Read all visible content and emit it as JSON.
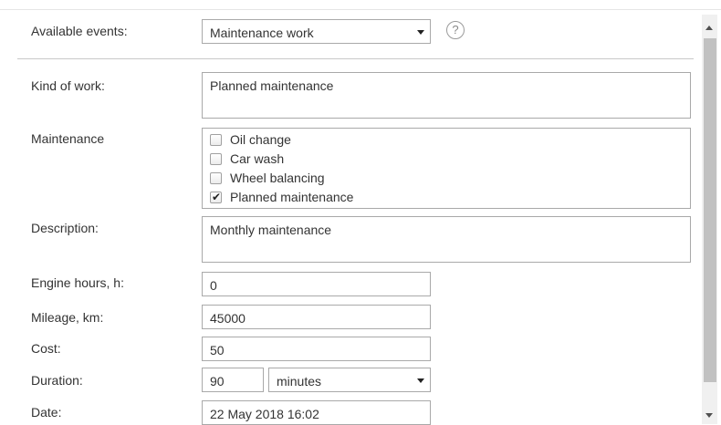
{
  "fields": {
    "available_events": {
      "label": "Available events:",
      "value": "Maintenance work"
    },
    "help": {
      "glyph": "?"
    },
    "kind_of_work": {
      "label": "Kind of work:",
      "value": "Planned maintenance"
    },
    "maintenance": {
      "label": "Maintenance",
      "options": [
        {
          "label": "Oil change",
          "checked": false
        },
        {
          "label": "Car wash",
          "checked": false
        },
        {
          "label": "Wheel balancing",
          "checked": false
        },
        {
          "label": "Planned maintenance",
          "checked": true
        }
      ]
    },
    "description": {
      "label": "Description:",
      "value": "Monthly maintenance"
    },
    "engine_hours": {
      "label": "Engine hours, h:",
      "value": "0"
    },
    "mileage": {
      "label": "Mileage, km:",
      "value": "45000"
    },
    "cost": {
      "label": "Cost:",
      "value": "50"
    },
    "duration": {
      "label": "Duration:",
      "value": "90",
      "unit": "minutes"
    },
    "date": {
      "label": "Date:",
      "value": "22 May 2018 16:02"
    }
  }
}
